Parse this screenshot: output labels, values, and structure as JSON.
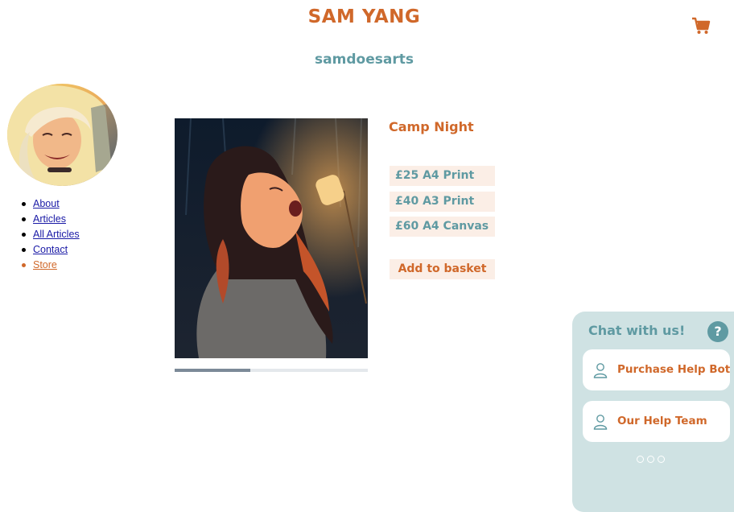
{
  "header": {
    "title": "SAM YANG",
    "subtitle": "samdoesarts",
    "cart_icon": "shopping-cart-icon"
  },
  "sidebar": {
    "avatar_icon": "artist-avatar",
    "nav": [
      {
        "label": "About",
        "active": false
      },
      {
        "label": "Articles",
        "active": false
      },
      {
        "label": "All Articles",
        "active": false
      },
      {
        "label": "Contact",
        "active": false
      },
      {
        "label": "Store",
        "active": true
      }
    ]
  },
  "product": {
    "title": "Camp Night",
    "options": [
      {
        "label": "£25 A4 Print"
      },
      {
        "label": "£40 A3 Print"
      },
      {
        "label": "£60 A4 Canvas"
      }
    ],
    "add_label": "Add to basket",
    "gallery_progress": 0.39
  },
  "chat": {
    "title": "Chat with us!",
    "help_icon": "?",
    "buttons": [
      {
        "label": "Purchase Help Bot",
        "icon": "person-icon"
      },
      {
        "label": "Our Help Team",
        "icon": "person-icon"
      }
    ],
    "more_icon": "ellipsis-dots-icon"
  },
  "colors": {
    "accent": "#d0682a",
    "teal": "#5f9aa2",
    "option_bg": "#fbeee6",
    "chat_bg": "#cfe2e3",
    "link": "#1a1aa6"
  }
}
